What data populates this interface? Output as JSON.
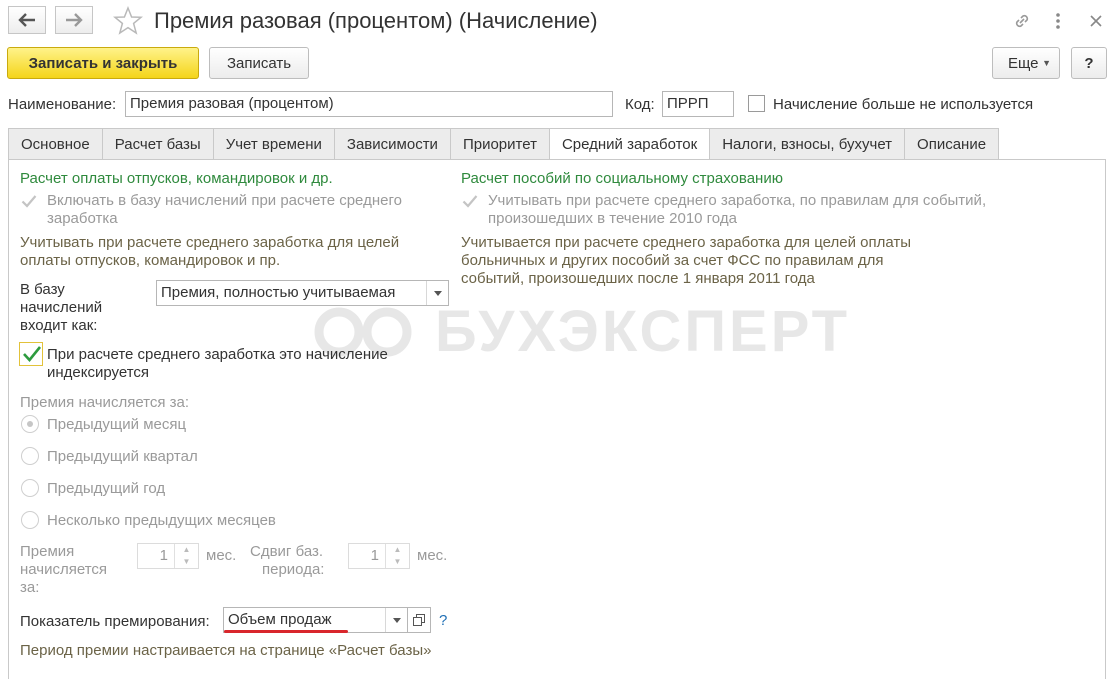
{
  "window": {
    "title": "Премия разовая (процентом) (Начисление)"
  },
  "toolbar": {
    "save_close_label": "Записать и закрыть",
    "save_label": "Записать",
    "more_label": "Еще",
    "help_label": "?"
  },
  "form": {
    "name_label": "Наименование:",
    "name_value": "Премия разовая (процентом)",
    "code_label": "Код:",
    "code_value": "ПРРП",
    "unused_label": "Начисление больше не используется"
  },
  "tabs": [
    {
      "label": "Основное"
    },
    {
      "label": "Расчет базы"
    },
    {
      "label": "Учет времени"
    },
    {
      "label": "Зависимости"
    },
    {
      "label": "Приоритет"
    },
    {
      "label": "Средний заработок"
    },
    {
      "label": "Налоги, взносы, бухучет"
    },
    {
      "label": "Описание"
    }
  ],
  "left": {
    "heading": "Расчет оплаты отпусков, командировок и др.",
    "include_line1": "Включать в базу начислений при расчете среднего",
    "include_line2": "заработка",
    "note_line1": "Учитывать при расчете среднего заработка для целей",
    "note_line2": "оплаты отпусков, командировок и пр.",
    "base_label_1": "В базу",
    "base_label_2": "начислений",
    "base_label_3": "входит как:",
    "base_value": "Премия, полностью учитываемая",
    "index_line1": "При расчете среднего заработка это начисление",
    "index_line2": "индексируется",
    "period_heading": "Премия начисляется за:",
    "radio_options": [
      "Предыдущий месяц",
      "Предыдущий квартал",
      "Предыдущий год",
      "Несколько предыдущих месяцев"
    ],
    "count_label_1": "Премия",
    "count_label_2": "начисляется",
    "count_label_3": "за:",
    "count_value": "1",
    "count_unit": "мес.",
    "shift_label_1": "Сдвиг баз.",
    "shift_label_2": "периода:",
    "shift_value": "1",
    "shift_unit": "мес.",
    "indicator_label": "Показатель премирования:",
    "indicator_value": "Объем продаж",
    "indicator_help": "?",
    "period_note": "Период премии настраивается на странице «Расчет базы»"
  },
  "right": {
    "heading": "Расчет пособий по социальному страхованию",
    "check_line1": "Учитывать при расчете среднего заработка, по правилам для событий,",
    "check_line2": "произошедших в течение 2010 года",
    "note_line1": "Учитывается при расчете среднего заработка для целей оплаты",
    "note_line2": "больничных и других пособий за счет ФСС по правилам для",
    "note_line3": "событий, произошедших после 1 января 2011 года"
  },
  "watermark": {
    "text": "БУХЭКСПЕРТ"
  },
  "colors": {
    "primary_button": "#f4d51a",
    "green_heading": "#2f8a3d",
    "underline_red": "#d9262c",
    "check_green": "#2d9b3e"
  }
}
